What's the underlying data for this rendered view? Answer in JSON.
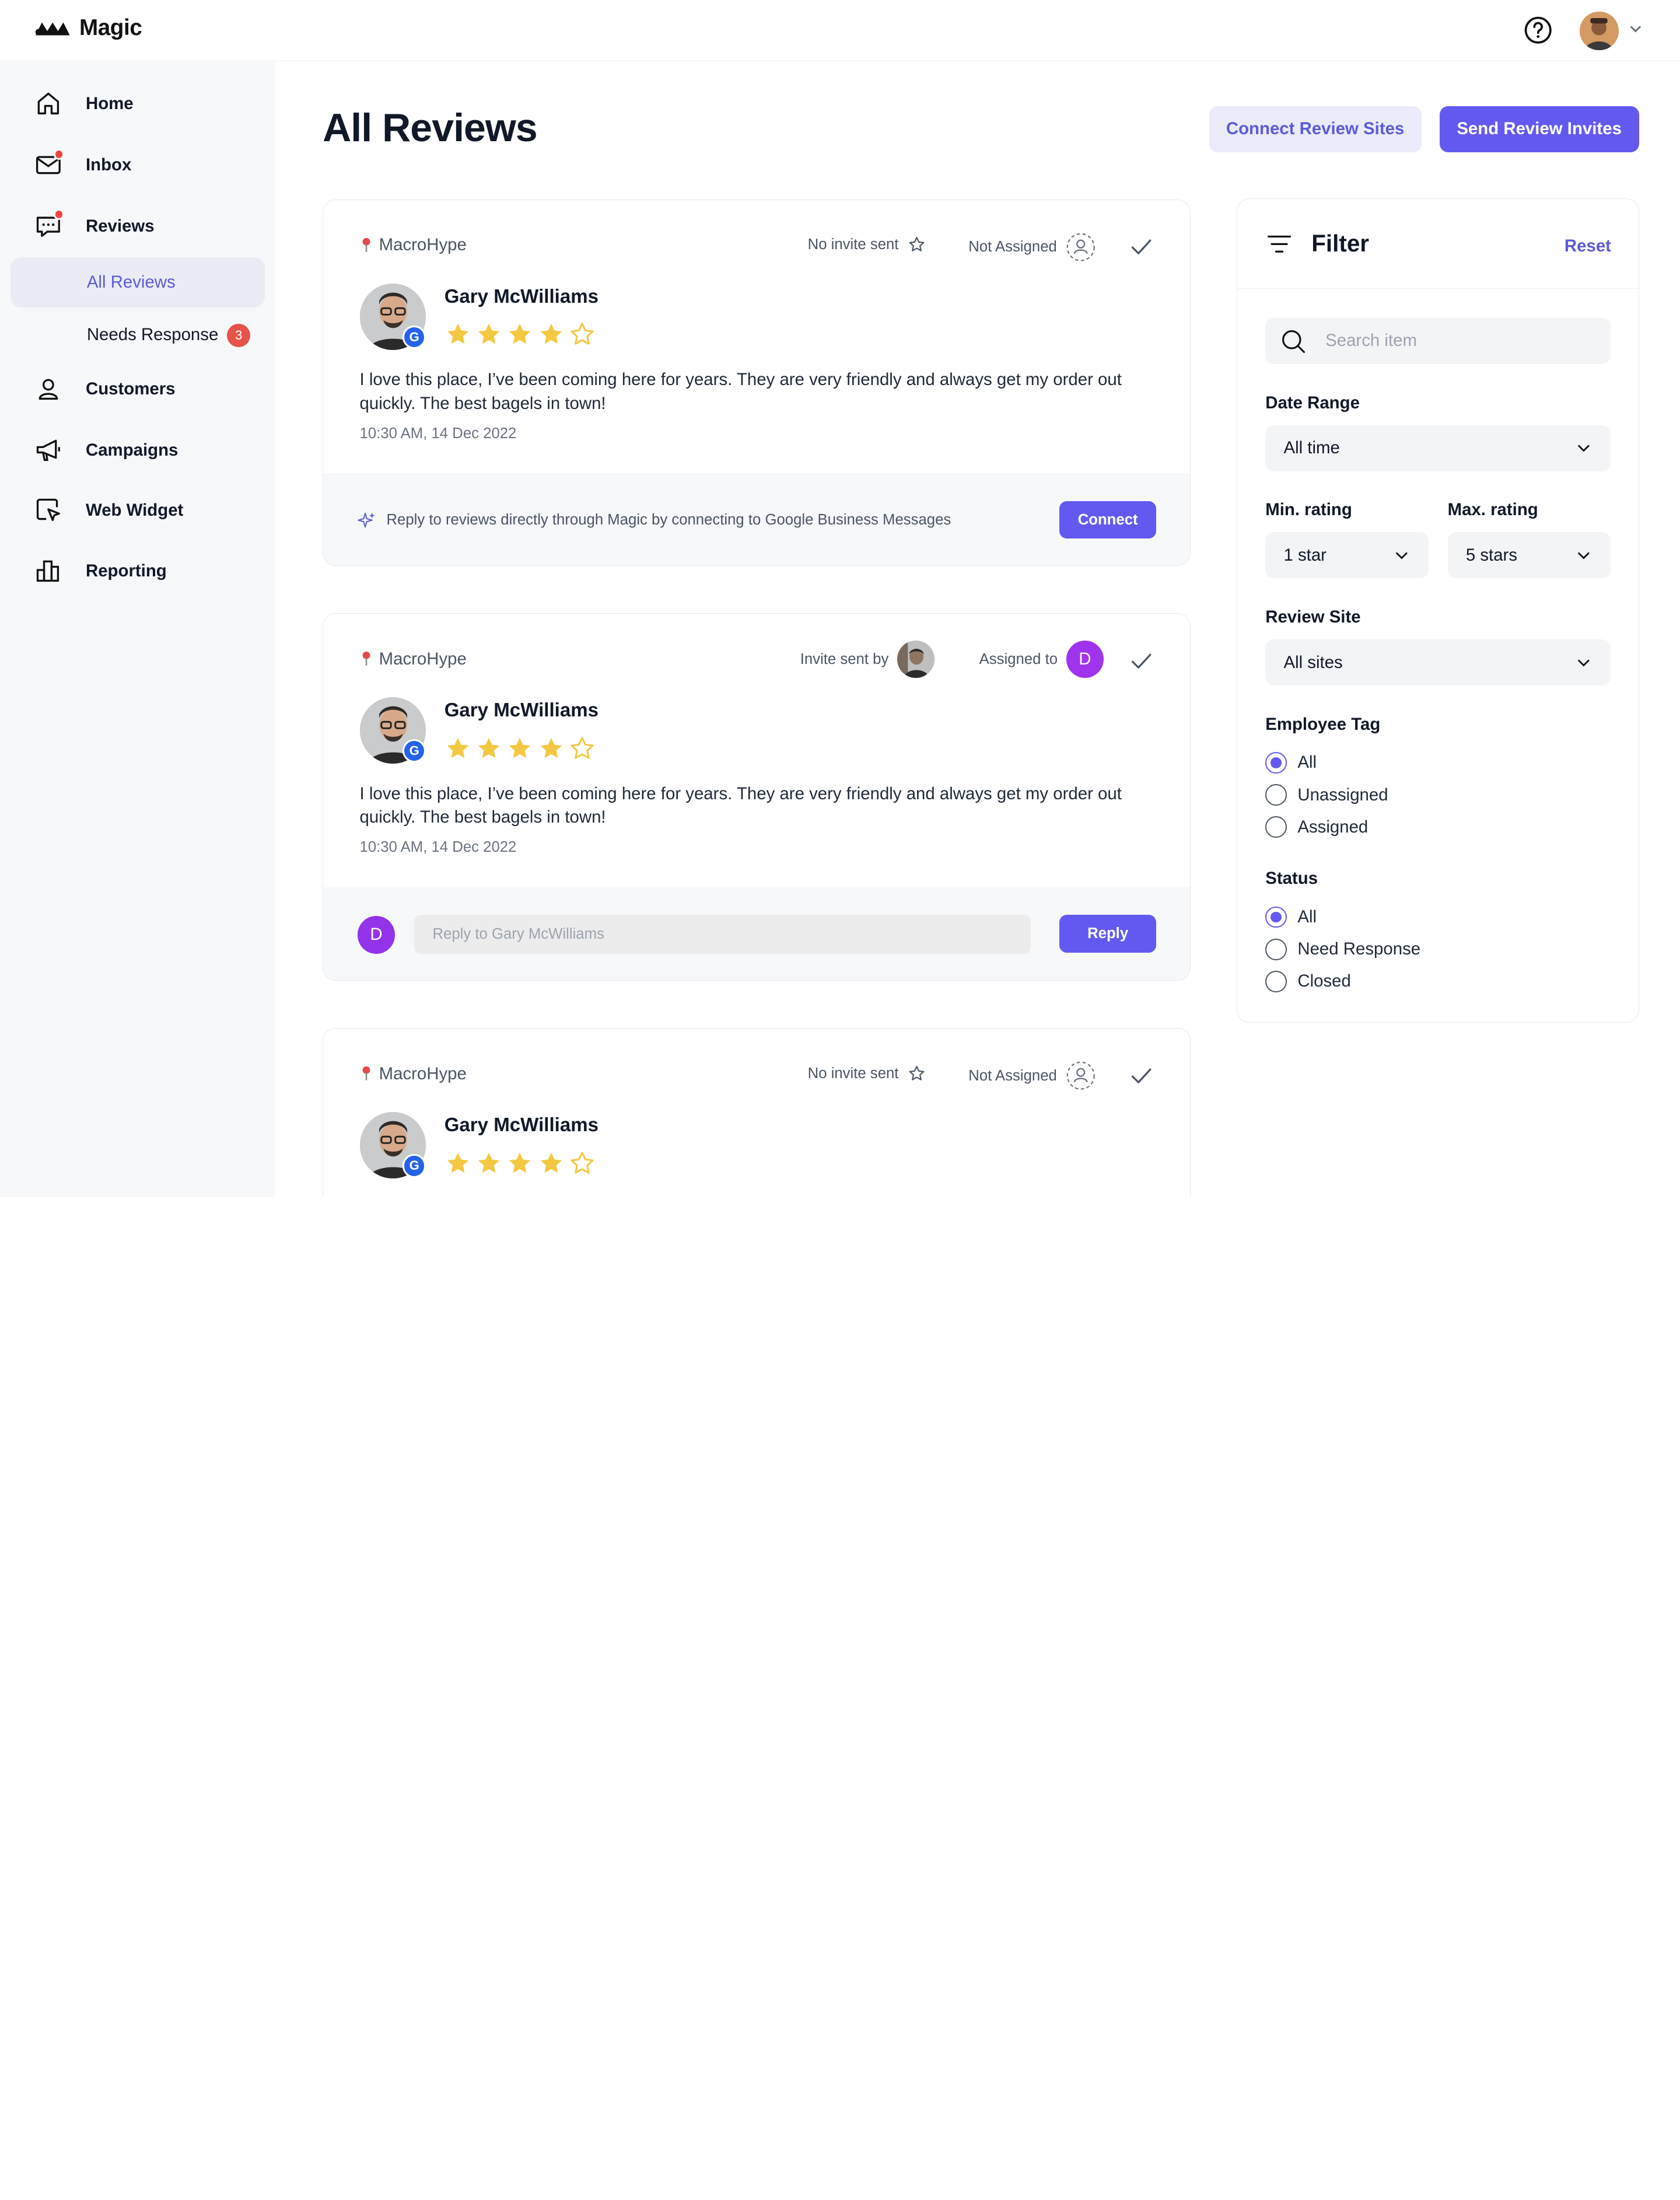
{
  "app": {
    "brand": "Magic"
  },
  "sidebar": {
    "items": [
      {
        "label": "Home",
        "icon": "home-icon"
      },
      {
        "label": "Inbox",
        "icon": "mail-icon"
      },
      {
        "label": "Reviews",
        "icon": "chat-icon"
      },
      {
        "label": "Customers",
        "icon": "user-icon"
      },
      {
        "label": "Campaigns",
        "icon": "megaphone-icon"
      },
      {
        "label": "Web Widget",
        "icon": "pointer-icon"
      },
      {
        "label": "Reporting",
        "icon": "chart-icon"
      }
    ],
    "sub": {
      "all_reviews": "All Reviews",
      "needs_response": "Needs Response",
      "needs_response_count": "3"
    }
  },
  "page": {
    "title": "All Reviews",
    "connect_sites": "Connect Review Sites",
    "send_invites": "Send Review Invites"
  },
  "reviews": [
    {
      "location": "MacroHype",
      "invite_text": "No invite sent",
      "assign_text": "Not Assigned",
      "name": "Gary McWilliams",
      "rating": 4,
      "text": "I love this place, I’ve been coming here for years. They are very friendly and always get my order out quickly. The best bagels in town!",
      "time": "10:30 AM, 14 Dec 2022",
      "footer_text": "Reply to reviews directly through Magic by connecting to Google Business Messages",
      "footer_button": "Connect"
    },
    {
      "location": "MacroHype",
      "invite_text": "Invite sent by",
      "assign_text": "Assigned to",
      "assignee_initial": "D",
      "name": "Gary McWilliams",
      "rating": 4,
      "text": "I love this place, I’ve been coming here for years. They are very friendly and always get my order out quickly. The best bagels in town!",
      "time": "10:30 AM, 14 Dec 2022",
      "reply_initial": "D",
      "reply_placeholder": "Reply to Gary McWilliams",
      "reply_button": "Reply"
    },
    {
      "location": "MacroHype",
      "invite_text": "No invite sent",
      "assign_text": "Not Assigned",
      "name": "Gary McWilliams",
      "rating": 4
    }
  ],
  "filter": {
    "title": "Filter",
    "reset": "Reset",
    "search_placeholder": "Search item",
    "date_range_label": "Date Range",
    "date_range_value": "All time",
    "min_label": "Min. rating",
    "min_value": "1 star",
    "max_label": "Max. rating",
    "max_value": "5 stars",
    "site_label": "Review Site",
    "site_value": "All sites",
    "employee_label": "Employee Tag",
    "employee_options": [
      "All",
      "Unassigned",
      "Assigned"
    ],
    "employee_selected": "All",
    "status_label": "Status",
    "status_options": [
      "All",
      "Need Response",
      "Closed"
    ],
    "status_selected": "All"
  },
  "colors": {
    "accent": "#6359f0",
    "accent_light": "#ecebfc",
    "star": "#f5c842",
    "badge": "#e5534b"
  }
}
